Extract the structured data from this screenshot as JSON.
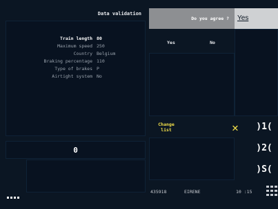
{
  "header": {
    "title": "Data validation"
  },
  "train_data": {
    "rows": [
      {
        "label": "Train length",
        "value": "80"
      },
      {
        "label": "Maximum speed",
        "value": "250"
      },
      {
        "label": "Country",
        "value": "Belgium"
      },
      {
        "label": "Braking percentage",
        "value": "110"
      },
      {
        "label": "Type of brakes",
        "value": "P"
      },
      {
        "label": "Airtight system",
        "value": "No"
      }
    ]
  },
  "question": {
    "text": "Do you agree ?",
    "answer": "Yes"
  },
  "options": {
    "yes": "Yes",
    "no": "No"
  },
  "actions": {
    "change_list_line1": "Change",
    "change_list_line2": "list",
    "confirm_symbol": "✕"
  },
  "side_buttons": {
    "b1": ")1(",
    "b2": ")2(",
    "b3": ")S("
  },
  "numeric_field": {
    "value": "0"
  },
  "status": {
    "train_number": "435918",
    "network": "EIRENE",
    "time": "10 :15"
  }
}
